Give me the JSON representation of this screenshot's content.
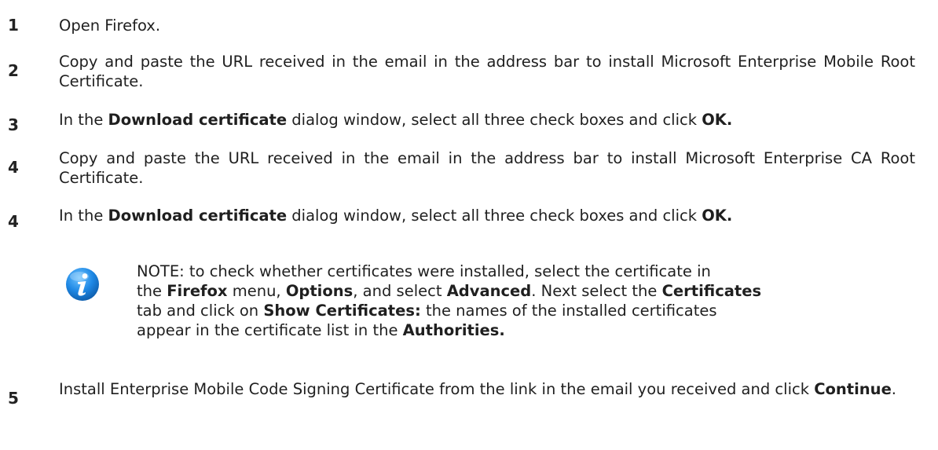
{
  "steps": [
    {
      "number": "1",
      "segments": [
        {
          "text": "Open Firefox.",
          "bold": false
        }
      ]
    },
    {
      "number": "2",
      "segments": [
        {
          "text": "Copy and paste the URL received in the email in the address bar to install Microsoft Enterprise Mobile Root Certificate.",
          "bold": false
        }
      ]
    },
    {
      "number": "3",
      "segments": [
        {
          "text": "In the ",
          "bold": false
        },
        {
          "text": "Download certificate",
          "bold": true
        },
        {
          "text": " dialog window, select all three check boxes and click ",
          "bold": false
        },
        {
          "text": "OK.",
          "bold": true
        }
      ]
    },
    {
      "number": "4",
      "segments": [
        {
          "text": "Copy and paste the URL received in the email in the address bar to install Microsoft Enterprise CA Root Certificate.",
          "bold": false
        }
      ]
    },
    {
      "number": "4",
      "segments": [
        {
          "text": "In the ",
          "bold": false
        },
        {
          "text": "Download certificate",
          "bold": true
        },
        {
          "text": " dialog window, select all three check boxes and click ",
          "bold": false
        },
        {
          "text": "OK.",
          "bold": true
        }
      ]
    },
    {
      "number": "5",
      "segments": [
        {
          "text": "Install Enterprise Mobile Code Signing Certificate from the link in the email you received and click ",
          "bold": false
        },
        {
          "text": "Continue",
          "bold": true
        },
        {
          "text": ".",
          "bold": false
        }
      ]
    }
  ],
  "note": {
    "icon": "info-icon",
    "icon_color": "#1e88e5",
    "lines": [
      [
        {
          "text": "NOTE: to check whether certificates were installed, select the certificate in",
          "bold": false
        }
      ],
      [
        {
          "text": "the ",
          "bold": false
        },
        {
          "text": "Firefox",
          "bold": true
        },
        {
          "text": " menu, ",
          "bold": false
        },
        {
          "text": "Options",
          "bold": true
        },
        {
          "text": ", and select ",
          "bold": false
        },
        {
          "text": "Advanced",
          "bold": true
        },
        {
          "text": ". Next select the ",
          "bold": false
        },
        {
          "text": "Certificates",
          "bold": true
        }
      ],
      [
        {
          "text": "tab and click on ",
          "bold": false
        },
        {
          "text": "Show Certificates:",
          "bold": true
        },
        {
          "text": " the names of the installed certificates",
          "bold": false
        }
      ],
      [
        {
          "text": "appear in the certificate list in the ",
          "bold": false
        },
        {
          "text": "Authorities.",
          "bold": true
        }
      ]
    ]
  }
}
